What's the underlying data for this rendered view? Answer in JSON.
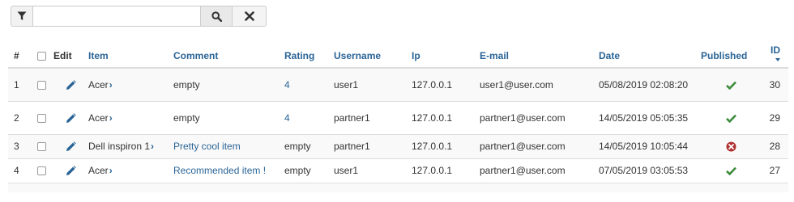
{
  "filter": {
    "filter_icon": "filter-icon",
    "input_value": "",
    "input_placeholder": "",
    "search_icon": "search-icon",
    "clear_icon": "close-icon"
  },
  "table": {
    "columns": {
      "num": "#",
      "edit": "Edit",
      "item": "Item",
      "comment": "Comment",
      "rating": "Rating",
      "username": "Username",
      "ip": "Ip",
      "email": "E-mail",
      "date": "Date",
      "published": "Published",
      "id": "ID"
    },
    "rows": [
      {
        "num": "1",
        "item": "Acer",
        "comment": "empty",
        "rating": "4",
        "username": "user1",
        "ip": "127.0.0.1",
        "email": "user1@user.com",
        "date": "05/08/2019 02:08:20",
        "published": "check",
        "id": "30"
      },
      {
        "num": "2",
        "item": "Acer",
        "comment": "empty",
        "rating": "4",
        "username": "partner1",
        "ip": "127.0.0.1",
        "email": "partner1@user.com",
        "date": "14/05/2019 05:05:35",
        "published": "check",
        "id": "29"
      },
      {
        "num": "3",
        "item": "Dell inspiron 1",
        "comment": "Pretty cool item",
        "rating": "empty",
        "username": "partner1",
        "ip": "127.0.0.1",
        "email": "partner1@user.com",
        "date": "14/05/2019 10:05:44",
        "published": "cross",
        "id": "28"
      },
      {
        "num": "4",
        "item": "Acer",
        "comment": "Recommended item !",
        "rating": "empty",
        "username": "user1",
        "ip": "127.0.0.1",
        "email": "partner1@user.com",
        "date": "07/05/2019 03:05:53",
        "published": "check",
        "id": "27"
      }
    ]
  },
  "colors": {
    "link": "#2a6496",
    "published_check": "#3c8c3c",
    "unpublished_cross": "#b03030",
    "edit_icon": "#2a6496"
  }
}
